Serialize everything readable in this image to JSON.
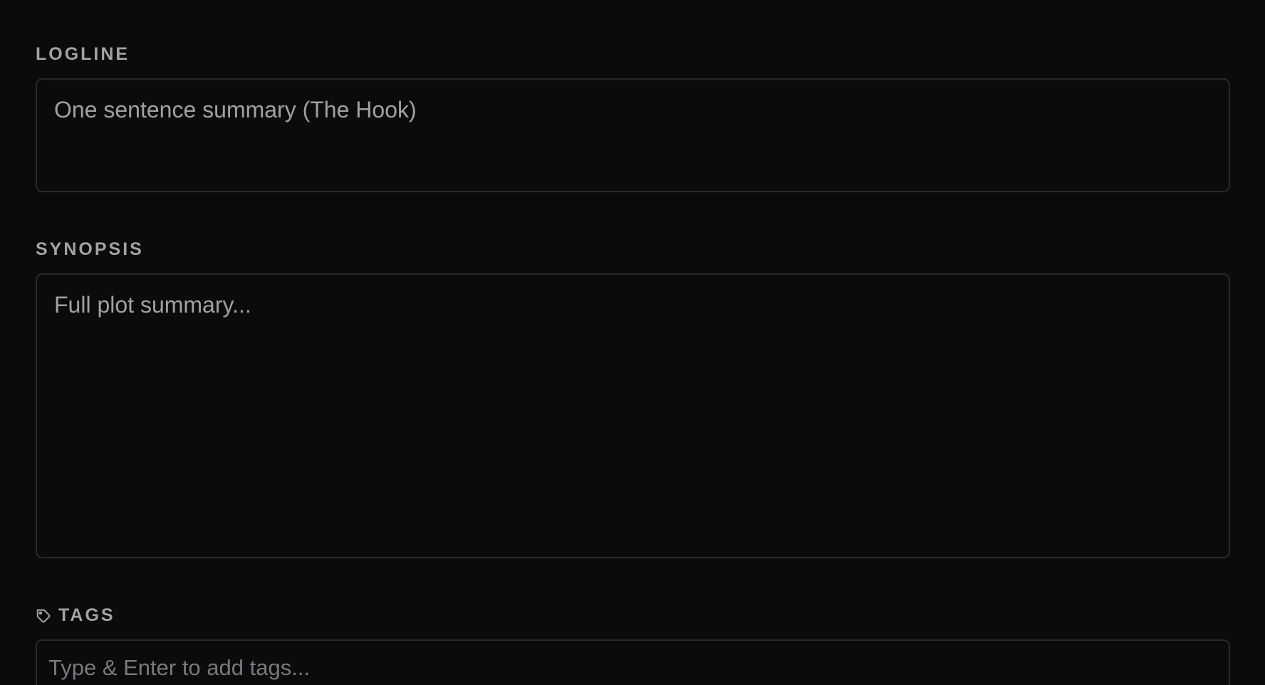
{
  "logline": {
    "label": "LOGLINE",
    "placeholder": "One sentence summary (The Hook)"
  },
  "synopsis": {
    "label": "SYNOPSIS",
    "placeholder": "Full plot summary..."
  },
  "tags": {
    "label": "TAGS",
    "icon": "tag-icon",
    "placeholder": "Type & Enter to add tags..."
  },
  "colors": {
    "background": "#0b0b0c",
    "border": "#2a2a2c",
    "label": "#a3a3a3",
    "placeholder": "#a1a1a4"
  }
}
